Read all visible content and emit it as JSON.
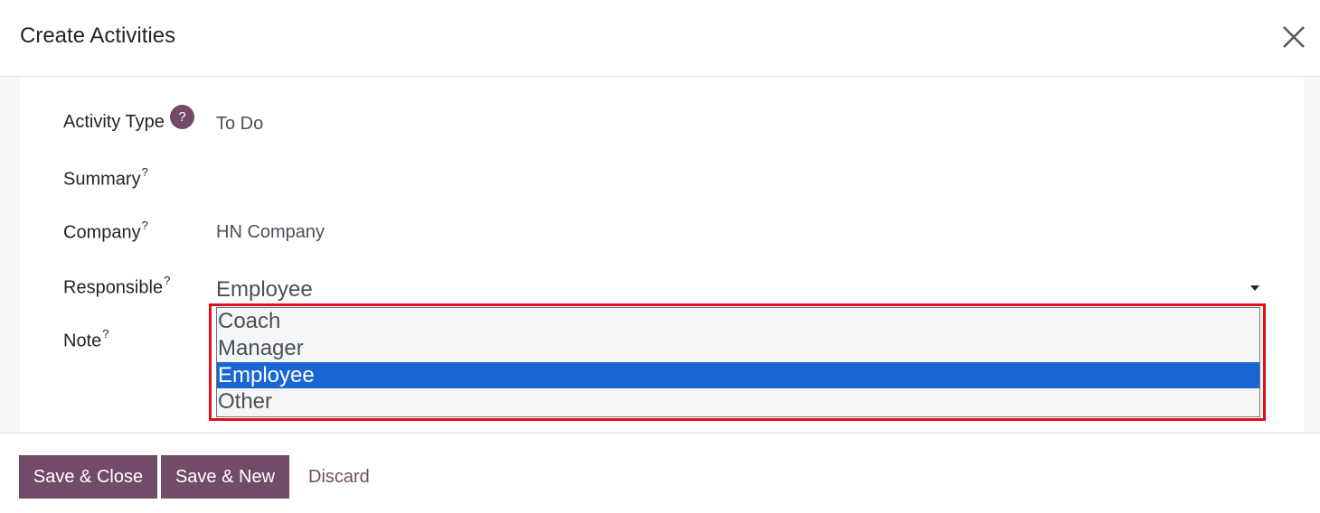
{
  "dialog": {
    "title": "Create Activities",
    "close_icon": "close-icon"
  },
  "form": {
    "activity_type": {
      "label": "Activity Type",
      "help": "?",
      "value": "To Do"
    },
    "summary": {
      "label": "Summary",
      "help": "?",
      "value": ""
    },
    "company": {
      "label": "Company",
      "help": "?",
      "value": "HN Company"
    },
    "responsible": {
      "label": "Responsible",
      "help": "?",
      "value": "Employee",
      "options": [
        "Coach",
        "Manager",
        "Employee",
        "Other"
      ],
      "selected_option": "Employee"
    },
    "note": {
      "label": "Note",
      "help": "?"
    }
  },
  "footer": {
    "save_close": "Save & Close",
    "save_new": "Save & New",
    "discard": "Discard"
  },
  "colors": {
    "brand": "#714b67",
    "selection": "#1a66d4",
    "highlight": "#e0101a"
  }
}
